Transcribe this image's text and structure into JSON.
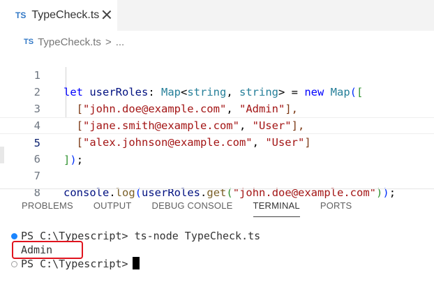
{
  "tab": {
    "badge": "TS",
    "label": "TypeCheck.ts"
  },
  "breadcrumb": {
    "badge": "TS",
    "file": "TypeCheck.ts",
    "separator": ">",
    "ellipsis": "..."
  },
  "editor": {
    "current_line": 5,
    "lines": [
      {
        "number": "1",
        "tokens": [
          "let ",
          "userRoles",
          ": ",
          "Map",
          "<",
          "string",
          ", ",
          "string",
          "> = ",
          "new ",
          "Map",
          "(",
          "["
        ]
      },
      {
        "number": "2",
        "tokens": [
          "  [",
          "\"john.doe@example.com\"",
          ", ",
          "\"Admin\"",
          "],"
        ]
      },
      {
        "number": "3",
        "tokens": [
          "  [",
          "\"jane.smith@example.com\"",
          ", ",
          "\"User\"",
          "],"
        ]
      },
      {
        "number": "4",
        "tokens": [
          "  [",
          "\"alex.johnson@example.com\"",
          ", ",
          "\"User\"",
          "]"
        ]
      },
      {
        "number": "5",
        "tokens": [
          "]",
          ")",
          ";"
        ]
      },
      {
        "number": "6",
        "tokens": []
      },
      {
        "number": "7",
        "tokens": [
          "console",
          ".",
          "log",
          "(",
          "userRoles",
          ".",
          "get",
          "(",
          "\"john.doe@example.com\"",
          ")",
          ")",
          ";"
        ]
      },
      {
        "number": "8",
        "tokens": []
      }
    ]
  },
  "panel": {
    "tabs": [
      "PROBLEMS",
      "OUTPUT",
      "DEBUG CONSOLE",
      "TERMINAL",
      "PORTS"
    ],
    "active_tab": "TERMINAL"
  },
  "terminal": {
    "lines": [
      {
        "prompt": "PS C:\\Typescript> ",
        "command": "ts-node TypeCheck.ts"
      },
      {
        "output": "Admin"
      },
      {
        "prompt": "PS C:\\Typescript>"
      }
    ]
  },
  "colors": {
    "ts_badge": "#3178c6",
    "keyword": "#0000ff",
    "string": "#a31515",
    "type": "#267f99",
    "highlight_box": "#e0141e",
    "terminal_dot": "#1a85ff"
  }
}
